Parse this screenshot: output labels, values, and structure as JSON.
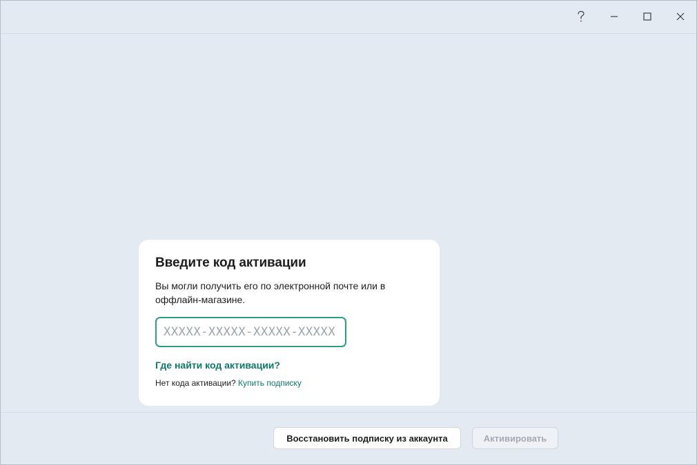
{
  "titlebar": {
    "help_icon": "question-mark-icon",
    "minimize_icon": "minimize-icon",
    "maximize_icon": "maximize-icon",
    "close_icon": "close-icon"
  },
  "card": {
    "title": "Введите код активации",
    "description": "Вы могли получить его по электронной почте или в оффлайн-магазине.",
    "input": {
      "value": "",
      "placeholder": "XXXXX-XXXXX-XXXXX-XXXXX"
    },
    "help_link": "Где найти код активации?",
    "no_code_text": "Нет кода активации?",
    "buy_link": "Купить подписку"
  },
  "footer": {
    "restore_button": "Восстановить подписку из аккаунта",
    "activate_button": "Активировать"
  },
  "colors": {
    "background": "#e4eaf2",
    "accent": "#0a7a6a",
    "input_border": "#2b9c8a",
    "disabled_text": "#a3aab4"
  }
}
